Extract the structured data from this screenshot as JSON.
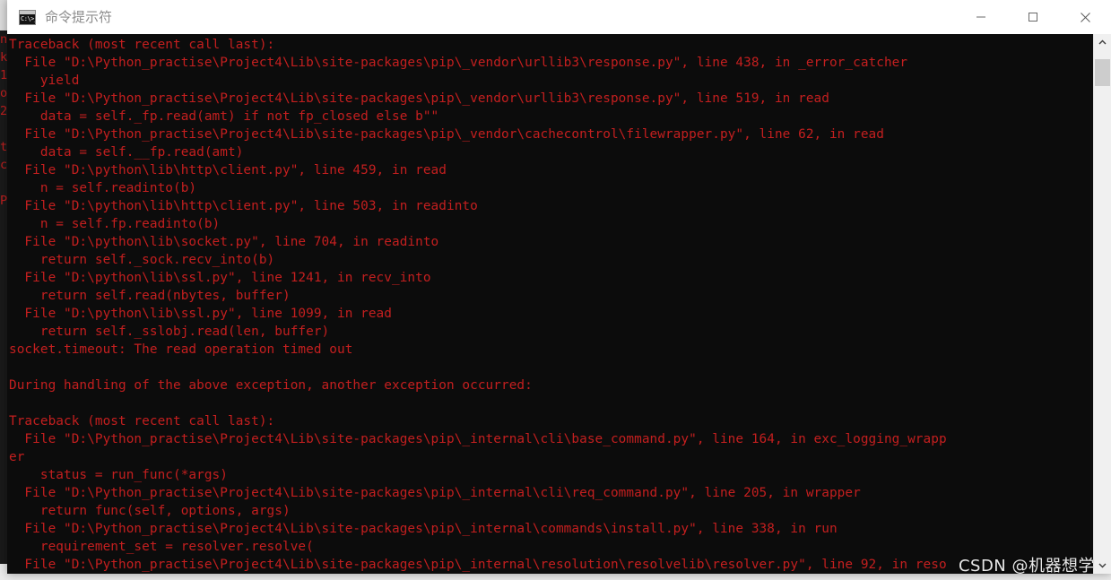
{
  "window": {
    "title": "命令提示符",
    "icon_name": "command-prompt-icon",
    "icon_text": "C:\\>_",
    "controls": {
      "minimize_label": "最小化",
      "maximize_label": "最大化",
      "close_label": "关闭"
    }
  },
  "colors": {
    "console_background": "#0c0c0c",
    "console_text": "#c41f1f",
    "titlebar_background": "#ffffff",
    "title_text": "#8c8c8c",
    "scrollbar_track": "#f0f0f0",
    "scrollbar_thumb": "#cdcdcd",
    "watermark": "#e8e8e8"
  },
  "console": {
    "lines": [
      "Traceback (most recent call last):",
      "  File \"D:\\Python_practise\\Project4\\Lib\\site-packages\\pip\\_vendor\\urllib3\\response.py\", line 438, in _error_catcher",
      "    yield",
      "  File \"D:\\Python_practise\\Project4\\Lib\\site-packages\\pip\\_vendor\\urllib3\\response.py\", line 519, in read",
      "    data = self._fp.read(amt) if not fp_closed else b\"\"",
      "  File \"D:\\Python_practise\\Project4\\Lib\\site-packages\\pip\\_vendor\\cachecontrol\\filewrapper.py\", line 62, in read",
      "    data = self.__fp.read(amt)",
      "  File \"D:\\python\\lib\\http\\client.py\", line 459, in read",
      "    n = self.readinto(b)",
      "  File \"D:\\python\\lib\\http\\client.py\", line 503, in readinto",
      "    n = self.fp.readinto(b)",
      "  File \"D:\\python\\lib\\socket.py\", line 704, in readinto",
      "    return self._sock.recv_into(b)",
      "  File \"D:\\python\\lib\\ssl.py\", line 1241, in recv_into",
      "    return self.read(nbytes, buffer)",
      "  File \"D:\\python\\lib\\ssl.py\", line 1099, in read",
      "    return self._sslobj.read(len, buffer)",
      "socket.timeout: The read operation timed out",
      "",
      "During handling of the above exception, another exception occurred:",
      "",
      "Traceback (most recent call last):",
      "  File \"D:\\Python_practise\\Project4\\Lib\\site-packages\\pip\\_internal\\cli\\base_command.py\", line 164, in exc_logging_wrapp",
      "er",
      "    status = run_func(*args)",
      "  File \"D:\\Python_practise\\Project4\\Lib\\site-packages\\pip\\_internal\\cli\\req_command.py\", line 205, in wrapper",
      "    return func(self, options, args)",
      "  File \"D:\\Python_practise\\Project4\\Lib\\site-packages\\pip\\_internal\\commands\\install.py\", line 338, in run",
      "    requirement_set = resolver.resolve(",
      "  File \"D:\\Python_practise\\Project4\\Lib\\site-packages\\pip\\_internal\\resolution\\resolvelib\\resolver.py\", line 92, in reso"
    ]
  },
  "background": {
    "left_window_text": "n\nk\n1\no\n2\n\nt\nc\n\nP"
  },
  "watermark": {
    "text": "CSDN @机器想学"
  }
}
